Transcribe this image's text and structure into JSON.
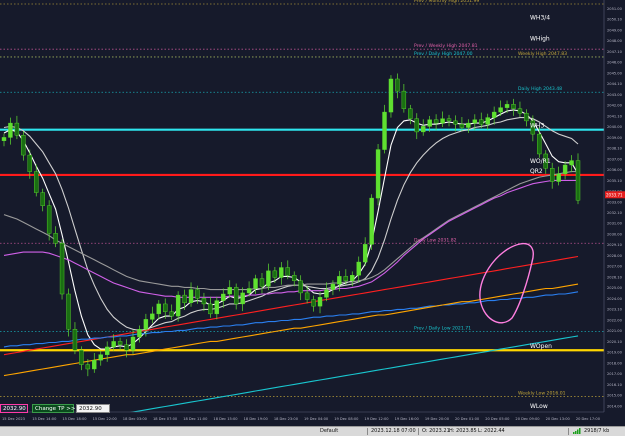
{
  "chart_data": {
    "type": "line",
    "title": "",
    "xlabel": "",
    "ylabel": "",
    "ylim": [
      2014.0,
      2051.0
    ],
    "grid": false,
    "x_tick_labels": [
      "15 Dec 2023",
      "15 Dec 14:00",
      "15 Dec 18:00",
      "15 Dec 22:00",
      "18 Dec 03:00",
      "18 Dec 07:00",
      "18 Dec 11:00",
      "18 Dec 15:00",
      "18 Dec 19:00",
      "18 Dec 23:00",
      "19 Dec 04:00",
      "19 Dec 08:00",
      "19 Dec 12:00",
      "19 Dec 16:00",
      "19 Dec 20:00",
      "20 Dec 01:00",
      "20 Dec 05:00",
      "20 Dec 09:00",
      "20 Dec 13:00",
      "20 Dec 17:00"
    ],
    "y_tick_labels": [
      "2051.00",
      "2050.10",
      "2049.00",
      "2048.00",
      "2047.10",
      "2046.00",
      "2045.00",
      "2044.10",
      "2043.00",
      "2042.00",
      "2041.10",
      "2040.00",
      "2039.00",
      "2038.10",
      "2037.00",
      "2036.00",
      "2035.10",
      "2034.00",
      "2033.00",
      "2032.10",
      "2031.00",
      "2030.00",
      "2029.10",
      "2028.00",
      "2027.00",
      "2026.10",
      "2025.00",
      "2024.00",
      "2023.10",
      "2022.00",
      "2021.00",
      "2020.10",
      "2019.00",
      "2018.00",
      "2017.00",
      "2016.10",
      "2015.00",
      "2014.00"
    ],
    "current_price_tag": "2033.71",
    "candles_close": [
      2038.9,
      2040.2,
      2039.1,
      2037.3,
      2035.8,
      2033.9,
      2032.7,
      2030.2,
      2029.3,
      2024.7,
      2021.5,
      2019.6,
      2018.3,
      2017.9,
      2018.7,
      2019.2,
      2019.9,
      2020.4,
      2020.1,
      2019.6,
      2020.8,
      2021.5,
      2022.4,
      2022.9,
      2023.8,
      2023.1,
      2022.7,
      2024.6,
      2023.9,
      2025.1,
      2024.3,
      2023.8,
      2022.9,
      2024.1,
      2024.7,
      2025.3,
      2023.8,
      2024.8,
      2025.2,
      2026.1,
      2025.4,
      2026.8,
      2026.2,
      2027.1,
      2026.4,
      2025.9,
      2024.8,
      2024.2,
      2023.6,
      2024.4,
      2025.1,
      2025.6,
      2026.3,
      2025.9,
      2026.4,
      2027.6,
      2029.2,
      2033.4,
      2037.8,
      2041.2,
      2044.2,
      2043.1,
      2041.5,
      2040.6,
      2039.4,
      2039.9,
      2040.5,
      2040.2,
      2040.6,
      2040.4,
      2040.1,
      2039.8,
      2040.2,
      2040.5,
      2040.1,
      2040.7,
      2041.2,
      2041.6,
      2041.9,
      2041.5,
      2041.1,
      2040.4,
      2039.2,
      2037.4,
      2036.1,
      2034.9,
      2035.6,
      2036.4,
      2036.8,
      2033.2
    ],
    "moving_averages": [
      {
        "color": "#ffffff",
        "values": [
          2039.3,
          2039.6,
          2039.4,
          2038.6,
          2037.5,
          2036.3,
          2035.2,
          2033.8,
          2032.4,
          2030.1,
          2027.6,
          2025.0,
          2022.7,
          2021.0,
          2020.1,
          2019.7,
          2019.7,
          2019.9,
          2020.0,
          2019.9,
          2020.2,
          2020.7,
          2021.3,
          2021.9,
          2022.5,
          2022.7,
          2022.7,
          2023.3,
          2023.5,
          2024.0,
          2024.1,
          2024.0,
          2023.7,
          2023.8,
          2024.1,
          2024.5,
          2024.3,
          2024.4,
          2024.6,
          2025.1,
          2025.2,
          2025.7,
          2025.9,
          2026.3,
          2026.3,
          2026.2,
          2025.8,
          2025.3,
          2024.8,
          2024.7,
          2024.8,
          2025.1,
          2025.5,
          2025.7,
          2025.9,
          2026.5,
          2027.4,
          2029.4,
          2032.2,
          2035.2,
          2038.2,
          2039.8,
          2040.4,
          2040.5,
          2040.2,
          2040.0,
          2040.1,
          2040.1,
          2040.2,
          2040.3,
          2040.2,
          2040.1,
          2040.1,
          2040.2,
          2040.2,
          2040.4,
          2040.7,
          2041.0,
          2041.3,
          2041.4,
          2041.3,
          2041.0,
          2040.4,
          2039.4,
          2038.3,
          2037.2,
          2036.7,
          2036.6,
          2036.6,
          2035.6
        ]
      },
      {
        "color": "#cfcfcf",
        "values": [
          2039.8,
          2039.9,
          2039.8,
          2039.5,
          2039.0,
          2038.3,
          2037.6,
          2036.6,
          2035.6,
          2034.2,
          2032.5,
          2030.6,
          2028.7,
          2026.9,
          2025.5,
          2024.3,
          2023.3,
          2022.6,
          2022.1,
          2021.7,
          2021.5,
          2021.4,
          2021.5,
          2021.7,
          2021.9,
          2022.1,
          2022.2,
          2022.5,
          2022.7,
          2023.0,
          2023.2,
          2023.3,
          2023.3,
          2023.4,
          2023.6,
          2023.8,
          2023.8,
          2023.9,
          2024.1,
          2024.3,
          2024.5,
          2024.8,
          2025.0,
          2025.2,
          2025.4,
          2025.5,
          2025.5,
          2025.4,
          2025.3,
          2025.2,
          2025.2,
          2025.3,
          2025.4,
          2025.5,
          2025.6,
          2025.8,
          2026.1,
          2026.8,
          2028.0,
          2029.6,
          2031.5,
          2033.2,
          2034.6,
          2035.7,
          2036.6,
          2037.3,
          2037.9,
          2038.4,
          2038.8,
          2039.1,
          2039.3,
          2039.5,
          2039.6,
          2039.8,
          2039.9,
          2040.0,
          2040.2,
          2040.3,
          2040.5,
          2040.6,
          2040.7,
          2040.7,
          2040.6,
          2040.3,
          2039.9,
          2039.5,
          2039.2,
          2039.0,
          2038.8,
          2038.3
        ]
      },
      {
        "color": "#9a9a9a",
        "values": [
          2031.9,
          2031.7,
          2031.5,
          2031.2,
          2030.9,
          2030.6,
          2030.3,
          2030.0,
          2029.6,
          2029.3,
          2029.0,
          2028.7,
          2028.4,
          2028.1,
          2027.8,
          2027.5,
          2027.2,
          2026.9,
          2026.6,
          2026.3,
          2026.1,
          2025.9,
          2025.8,
          2025.7,
          2025.6,
          2025.5,
          2025.4,
          2025.4,
          2025.3,
          2025.3,
          2025.2,
          2025.2,
          2025.1,
          2025.1,
          2025.1,
          2025.1,
          2025.1,
          2025.1,
          2025.1,
          2025.2,
          2025.2,
          2025.3,
          2025.3,
          2025.4,
          2025.5,
          2025.5,
          2025.5,
          2025.6,
          2025.6,
          2025.6,
          2025.6,
          2025.7,
          2025.7,
          2025.8,
          2025.8,
          2025.9,
          2026.0,
          2026.2,
          2026.5,
          2026.9,
          2027.4,
          2027.9,
          2028.4,
          2028.9,
          2029.4,
          2029.8,
          2030.2,
          2030.6,
          2031.0,
          2031.4,
          2031.7,
          2032.0,
          2032.3,
          2032.6,
          2032.9,
          2033.2,
          2033.5,
          2033.8,
          2034.1,
          2034.4,
          2034.7,
          2034.9,
          2035.1,
          2035.3,
          2035.4,
          2035.5,
          2035.6,
          2035.7,
          2035.8,
          2035.8
        ]
      },
      {
        "color": "#d060e8",
        "values": [
          2028.2,
          2028.3,
          2028.4,
          2028.5,
          2028.5,
          2028.5,
          2028.5,
          2028.4,
          2028.2,
          2028.0,
          2027.8,
          2027.5,
          2027.2,
          2026.9,
          2026.6,
          2026.3,
          2026.0,
          2025.7,
          2025.5,
          2025.3,
          2025.1,
          2024.9,
          2024.8,
          2024.7,
          2024.6,
          2024.5,
          2024.5,
          2024.4,
          2024.4,
          2024.4,
          2024.4,
          2024.4,
          2024.4,
          2024.4,
          2024.4,
          2024.5,
          2024.5,
          2024.5,
          2024.6,
          2024.6,
          2024.7,
          2024.7,
          2024.8,
          2024.8,
          2024.9,
          2024.9,
          2025.0,
          2025.0,
          2025.0,
          2025.0,
          2025.1,
          2025.1,
          2025.2,
          2025.2,
          2025.3,
          2025.4,
          2025.6,
          2025.8,
          2026.2,
          2026.6,
          2027.1,
          2027.6,
          2028.2,
          2028.7,
          2029.2,
          2029.7,
          2030.1,
          2030.5,
          2030.9,
          2031.3,
          2031.6,
          2031.9,
          2032.2,
          2032.5,
          2032.8,
          2033.1,
          2033.4,
          2033.6,
          2033.9,
          2034.1,
          2034.3,
          2034.5,
          2034.7,
          2034.8,
          2034.9,
          2035.0,
          2035.0,
          2035.0,
          2035.0,
          2035.0
        ]
      },
      {
        "color": "#ff2020",
        "values": [
          2019.2,
          2019.3,
          2019.4,
          2019.5,
          2019.6,
          2019.7,
          2019.8,
          2019.9,
          2020.0,
          2020.1,
          2020.2,
          2020.3,
          2020.4,
          2020.5,
          2020.6,
          2020.7,
          2020.8,
          2020.9,
          2021.0,
          2021.1,
          2021.2,
          2021.3,
          2021.4,
          2021.5,
          2021.6,
          2021.7,
          2021.8,
          2021.9,
          2022.0,
          2022.1,
          2022.2,
          2022.3,
          2022.4,
          2022.5,
          2022.6,
          2022.7,
          2022.8,
          2022.9,
          2023.0,
          2023.1,
          2023.2,
          2023.3,
          2023.4,
          2023.5,
          2023.6,
          2023.7,
          2023.8,
          2023.9,
          2024.0,
          2024.1,
          2024.2,
          2024.3,
          2024.4,
          2024.5,
          2024.6,
          2024.7,
          2024.8,
          2024.9,
          2025.0,
          2025.1,
          2025.2,
          2025.3,
          2025.4,
          2025.5,
          2025.6,
          2025.7,
          2025.8,
          2025.9,
          2026.0,
          2026.1,
          2026.2,
          2026.3,
          2026.4,
          2026.5,
          2026.6,
          2026.7,
          2026.8,
          2026.9,
          2027.0,
          2027.1,
          2027.2,
          2027.3,
          2027.4,
          2027.5,
          2027.6,
          2027.7,
          2027.8,
          2027.9,
          2028.0,
          2028.1
        ]
      },
      {
        "color": "#2a7ff0",
        "values": [
          2019.9,
          2020.0,
          2020.0,
          2020.1,
          2020.1,
          2020.2,
          2020.2,
          2020.3,
          2020.3,
          2020.4,
          2020.4,
          2020.5,
          2020.6,
          2020.6,
          2020.7,
          2020.7,
          2020.8,
          2020.8,
          2020.9,
          2020.9,
          2021.0,
          2021.1,
          2021.1,
          2021.2,
          2021.2,
          2021.3,
          2021.3,
          2021.4,
          2021.4,
          2021.5,
          2021.6,
          2021.6,
          2021.7,
          2021.7,
          2021.8,
          2021.8,
          2021.9,
          2021.9,
          2022.0,
          2022.1,
          2022.1,
          2022.2,
          2022.2,
          2022.3,
          2022.3,
          2022.4,
          2022.4,
          2022.5,
          2022.6,
          2022.6,
          2022.7,
          2022.7,
          2022.8,
          2022.8,
          2022.9,
          2022.9,
          2023.0,
          2023.1,
          2023.1,
          2023.2,
          2023.2,
          2023.3,
          2023.3,
          2023.4,
          2023.4,
          2023.5,
          2023.6,
          2023.6,
          2023.7,
          2023.7,
          2023.8,
          2023.8,
          2023.9,
          2023.9,
          2024.0,
          2024.1,
          2024.1,
          2024.2,
          2024.2,
          2024.3,
          2024.3,
          2024.4,
          2024.4,
          2024.5,
          2024.6,
          2024.6,
          2024.7,
          2024.7,
          2024.8,
          2024.9
        ]
      },
      {
        "color": "#ffa500",
        "values": [
          2017.3,
          2017.4,
          2017.5,
          2017.6,
          2017.7,
          2017.8,
          2017.9,
          2018.0,
          2018.1,
          2018.2,
          2018.3,
          2018.4,
          2018.5,
          2018.6,
          2018.7,
          2018.8,
          2018.9,
          2019.0,
          2019.1,
          2019.2,
          2019.2,
          2019.3,
          2019.4,
          2019.5,
          2019.6,
          2019.7,
          2019.8,
          2019.9,
          2020.0,
          2020.1,
          2020.2,
          2020.3,
          2020.4,
          2020.4,
          2020.5,
          2020.6,
          2020.7,
          2020.8,
          2020.9,
          2021.0,
          2021.1,
          2021.2,
          2021.3,
          2021.4,
          2021.5,
          2021.6,
          2021.6,
          2021.7,
          2021.8,
          2021.9,
          2022.0,
          2022.1,
          2022.2,
          2022.3,
          2022.4,
          2022.5,
          2022.6,
          2022.7,
          2022.8,
          2022.8,
          2022.9,
          2023.0,
          2023.1,
          2023.2,
          2023.3,
          2023.4,
          2023.5,
          2023.6,
          2023.7,
          2023.8,
          2023.9,
          2024.0,
          2024.0,
          2024.1,
          2024.2,
          2024.3,
          2024.4,
          2024.5,
          2024.6,
          2024.7,
          2024.8,
          2024.9,
          2025.0,
          2025.1,
          2025.2,
          2025.2,
          2025.3,
          2025.4,
          2025.5,
          2025.6
        ]
      },
      {
        "color": "#19c6cf",
        "values": [
          2012.0,
          2012.1,
          2012.2,
          2012.3,
          2012.4,
          2012.5,
          2012.6,
          2012.7,
          2012.8,
          2012.9,
          2013.0,
          2013.1,
          2013.2,
          2013.3,
          2013.4,
          2013.5,
          2013.6,
          2013.7,
          2013.8,
          2013.9,
          2014.0,
          2014.1,
          2014.2,
          2014.3,
          2014.4,
          2014.5,
          2014.6,
          2014.7,
          2014.8,
          2014.9,
          2015.0,
          2015.1,
          2015.2,
          2015.3,
          2015.4,
          2015.5,
          2015.6,
          2015.7,
          2015.8,
          2015.9,
          2016.0,
          2016.1,
          2016.2,
          2016.3,
          2016.4,
          2016.5,
          2016.6,
          2016.7,
          2016.8,
          2016.9,
          2017.0,
          2017.1,
          2017.2,
          2017.3,
          2017.4,
          2017.5,
          2017.6,
          2017.7,
          2017.8,
          2017.9,
          2018.0,
          2018.1,
          2018.2,
          2018.3,
          2018.4,
          2018.5,
          2018.6,
          2018.7,
          2018.8,
          2018.9,
          2019.0,
          2019.1,
          2019.2,
          2019.3,
          2019.4,
          2019.5,
          2019.6,
          2019.7,
          2019.8,
          2019.9,
          2020.0,
          2020.1,
          2020.2,
          2020.3,
          2020.4,
          2020.5,
          2020.6,
          2020.7,
          2020.8,
          2020.9
        ]
      }
    ],
    "levels": [
      {
        "label": "Prev / Monthly High 2051.99",
        "value": 2051.0,
        "color": "#c2a63a",
        "style": "dotted",
        "label_color": "#c2a63a"
      },
      {
        "label": "WH3/4",
        "value": 2049.4,
        "color": "#ffffff",
        "style": "none",
        "label_color": "#ffffff"
      },
      {
        "label": "WHigh",
        "value": 2047.5,
        "color": "#ffffff",
        "style": "none",
        "label_color": "#ffffff"
      },
      {
        "label": "Prev / Weekly High 2047.81",
        "value": 2046.9,
        "color": "#e060a8",
        "style": "dotted",
        "label_color": "#e060a8"
      },
      {
        "label": "Prev / Daily High 2047.00",
        "value": 2046.2,
        "color": "#19c6cf",
        "style": "dotted",
        "label_color": "#19c6cf"
      },
      {
        "label": "Weekly High 2047.83",
        "value": 2046.2,
        "color": "#c2a63a",
        "style": "dotted",
        "label_color": "#c2a63a"
      },
      {
        "label": "Daily High 2043.48",
        "value": 2043.0,
        "color": "#19c6cf",
        "style": "dotted",
        "label_color": "#19c6cf"
      },
      {
        "label": "WH3",
        "value": 2039.6,
        "color": "#2ee6ee",
        "style": "solid",
        "label_color": "#ffffff"
      },
      {
        "label": "WO/R1",
        "value": 2036.4,
        "color": "#ffffff",
        "style": "none",
        "label_color": "#ffffff"
      },
      {
        "label": "QR2",
        "value": 2035.5,
        "color": "#ff1a1a",
        "style": "solid",
        "label_color": "#ffffff"
      },
      {
        "label": "Daily Low 2031.82",
        "value": 2029.3,
        "color": "#e060a8",
        "style": "dotted",
        "label_color": "#e060a8"
      },
      {
        "label": "Prev / Daily Low 2021.71",
        "value": 2021.3,
        "color": "#19c6cf",
        "style": "dotted",
        "label_color": "#19c6cf"
      },
      {
        "label": "WOpen",
        "value": 2019.6,
        "color": "#ffd700",
        "style": "solid",
        "label_color": "#ffffff"
      },
      {
        "label": "Weekly Low 2016.01",
        "value": 2015.4,
        "color": "#c2a63a",
        "style": "dotted",
        "label_color": "#c2a63a"
      },
      {
        "label": "WLow",
        "value": 2014.2,
        "color": "#ffffff",
        "style": "none",
        "label_color": "#ffffff"
      }
    ]
  },
  "overlay": {
    "left_price": "2032.90",
    "change_tp_label": "Change TP >>",
    "change_tp_value": "2032.90"
  },
  "statusbar": {
    "profile": "Default",
    "datetime": "2023.12.18 07:00",
    "open": "O: 2023.21",
    "high": "H: 2023.85",
    "low": "L: 2022.44",
    "traffic": "2918/7 kb"
  },
  "colors": {
    "background": "#161a2b",
    "candle_up": "#5fe030",
    "candle_down": "#1a6f12",
    "axis_text": "#b8b8c8",
    "highlight_circle": "#ff7fe0"
  }
}
